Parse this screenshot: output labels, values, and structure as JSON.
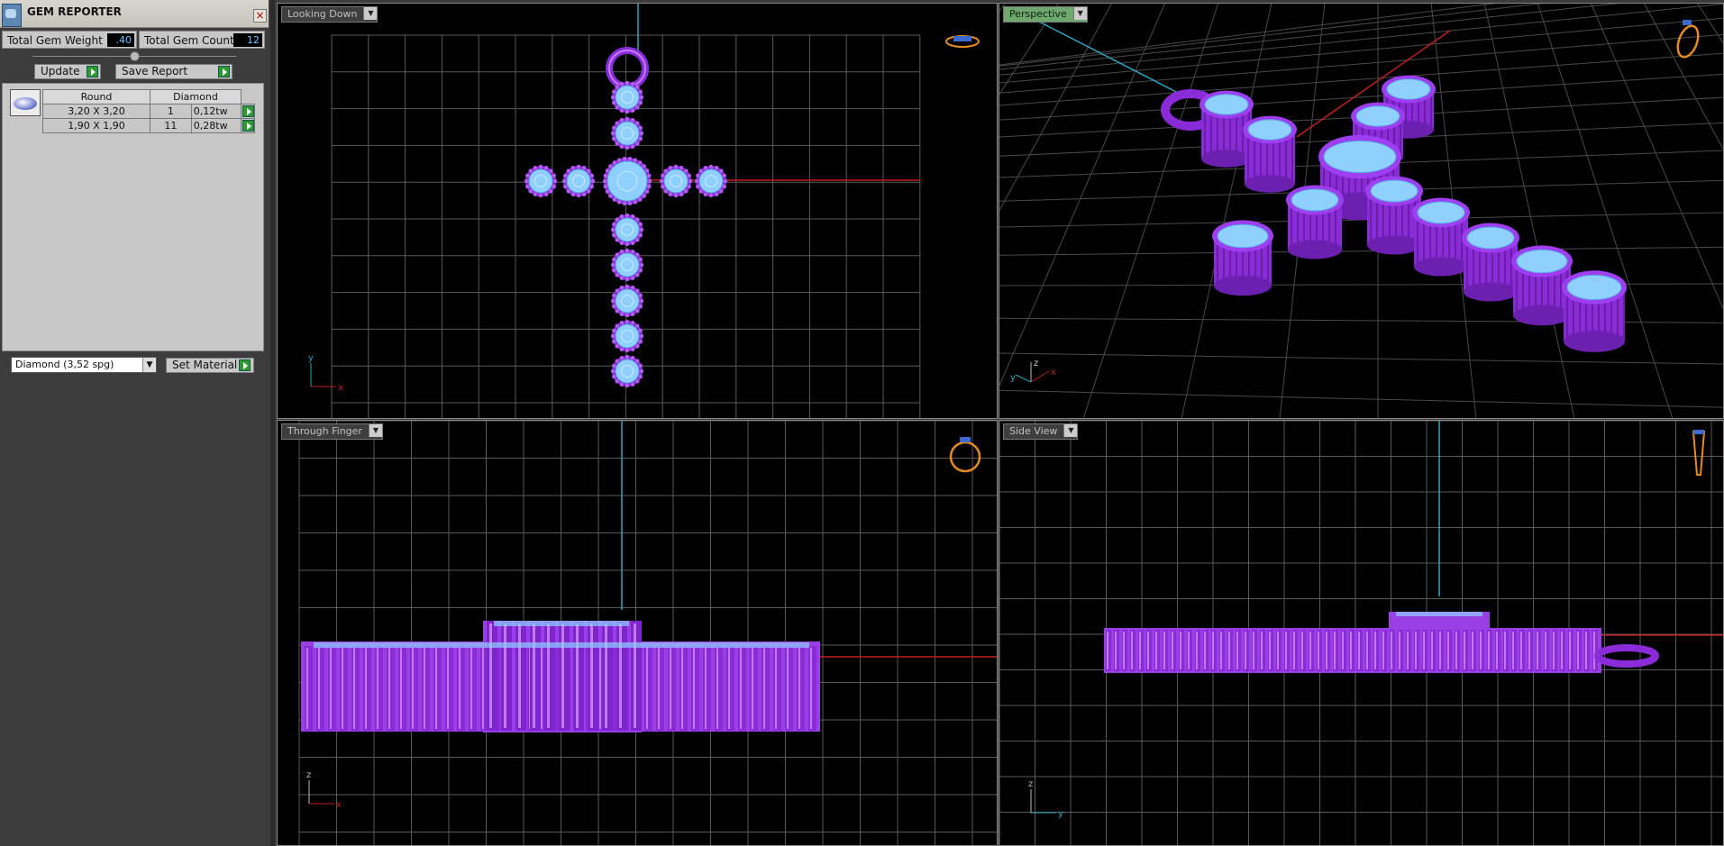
{
  "panel": {
    "title": "GEM REPORTER",
    "close_icon": "close-icon",
    "total_weight_label": "Total Gem Weight",
    "total_weight_value": ".40",
    "total_count_label": "Total Gem Count",
    "total_count_value": "12",
    "update_label": "Update",
    "save_report_label": "Save Report",
    "table_headers": [
      "Round",
      "Diamond"
    ],
    "rows": [
      {
        "size": "3,20 X 3,20",
        "count": "1",
        "weight": "0,12tw"
      },
      {
        "size": "1,90 X 1,90",
        "count": "11",
        "weight": "0,28tw"
      }
    ],
    "material_value": "Diamond    (3,52 spg)",
    "set_material_label": "Set Material"
  },
  "viewports": {
    "top_left": {
      "label": "Looking Down"
    },
    "top_right": {
      "label": "Perspective"
    },
    "bottom_left": {
      "label": "Through Finger"
    },
    "bottom_right": {
      "label": "Side View"
    }
  },
  "axes": {
    "x": "x",
    "y": "y",
    "z": "z"
  },
  "colors": {
    "metal": "#8a2bd8",
    "gem": "#8fd0ff",
    "grid": "#5a5a5a",
    "axis_red": "#c02020",
    "axis_cyan": "#2aa6c0",
    "accent_green": "#2f9a2f"
  }
}
